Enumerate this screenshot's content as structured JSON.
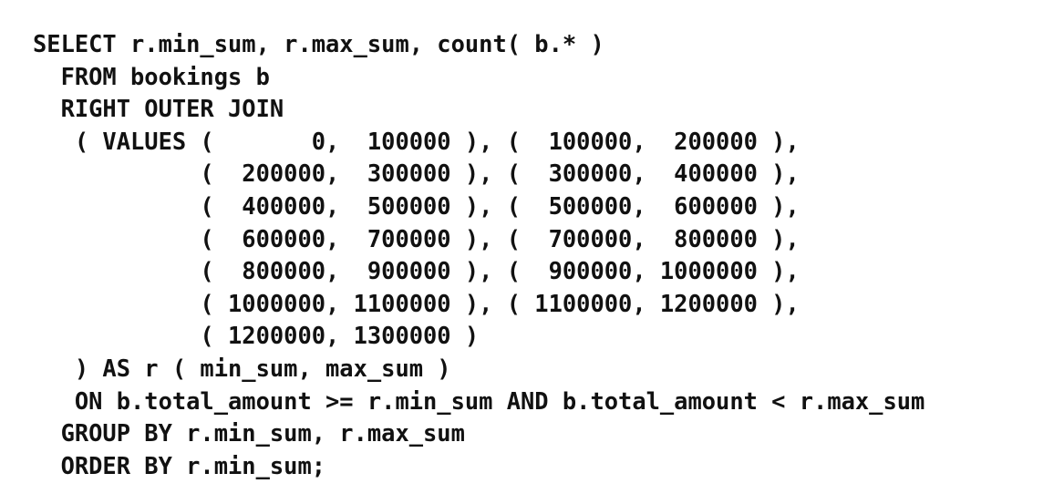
{
  "code": {
    "lines": [
      "SELECT r.min_sum, r.max_sum, count( b.* )",
      "  FROM bookings b",
      "  RIGHT OUTER JOIN",
      "   ( VALUES (       0,  100000 ), (  100000,  200000 ),",
      "            (  200000,  300000 ), (  300000,  400000 ),",
      "            (  400000,  500000 ), (  500000,  600000 ),",
      "            (  600000,  700000 ), (  700000,  800000 ),",
      "            (  800000,  900000 ), (  900000, 1000000 ),",
      "            ( 1000000, 1100000 ), ( 1100000, 1200000 ),",
      "            ( 1200000, 1300000 )",
      "   ) AS r ( min_sum, max_sum )",
      "   ON b.total_amount >= r.min_sum AND b.total_amount < r.max_sum",
      "  GROUP BY r.min_sum, r.max_sum",
      "  ORDER BY r.min_sum;"
    ]
  }
}
